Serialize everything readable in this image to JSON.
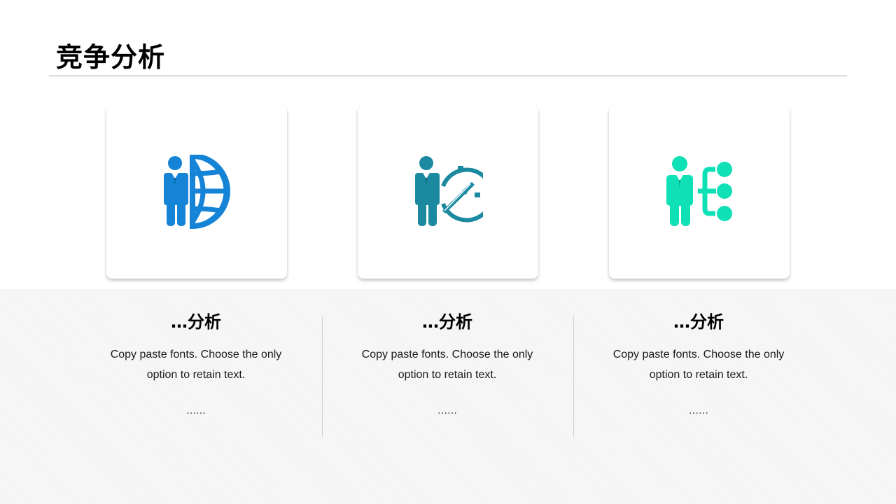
{
  "slide": {
    "title": "竞争分析"
  },
  "colors": {
    "blue": "#1584d6",
    "teal": "#1b8aa0",
    "mint": "#10e0b6"
  },
  "columns": [
    {
      "icon": "businessman-globe-icon",
      "title": "…分析",
      "text": "Copy paste fonts. Choose the only option to retain text.",
      "more": "……"
    },
    {
      "icon": "businessman-compass-icon",
      "title": "…分析",
      "text": "Copy paste fonts. Choose the only option to retain text.",
      "more": "……"
    },
    {
      "icon": "businessman-hierarchy-icon",
      "title": "…分析",
      "text": "Copy paste fonts. Choose the only option to retain text.",
      "more": "……"
    }
  ]
}
